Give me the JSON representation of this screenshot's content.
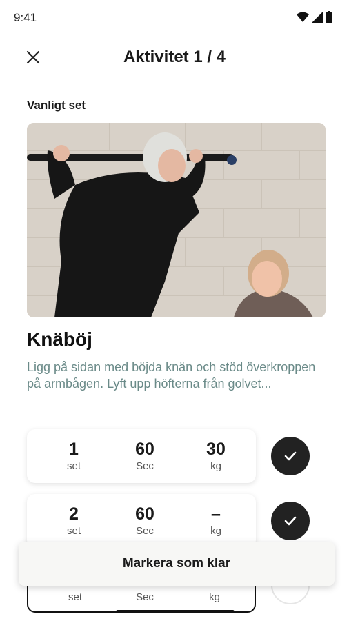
{
  "status": {
    "time": "9:41",
    "icons": [
      "wifi-icon",
      "signal-icon",
      "battery-icon"
    ]
  },
  "header": {
    "title": "Aktivitet 1 / 4",
    "close_icon": "close-icon"
  },
  "section": {
    "label": "Vanligt set"
  },
  "exercise": {
    "title": "Knäböj",
    "description": "Ligg på sidan med böjda knän och stöd överkroppen på armbågen. Lyft upp höfterna från golvet..."
  },
  "sets": [
    {
      "set": "1",
      "set_unit": "set",
      "time": "60",
      "time_unit": "Sec",
      "weight": "30",
      "weight_unit": "kg",
      "done": true
    },
    {
      "set": "2",
      "set_unit": "set",
      "time": "60",
      "time_unit": "Sec",
      "weight": "–",
      "weight_unit": "kg",
      "done": true
    },
    {
      "set_unit": "set",
      "time_unit": "Sec",
      "weight_unit": "kg",
      "done": false
    }
  ],
  "actions": {
    "mark_done": "Markera som klar"
  },
  "colors": {
    "accent_dark": "#222222",
    "description": "#6a8a88"
  }
}
